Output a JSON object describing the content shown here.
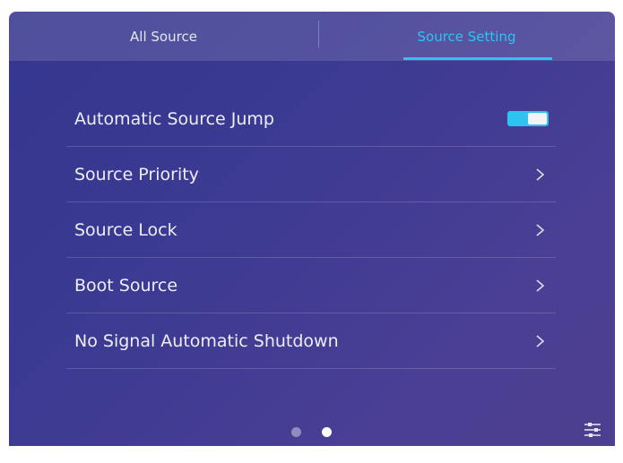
{
  "tabs": [
    {
      "label": "All Source",
      "active": false
    },
    {
      "label": "Source Setting",
      "active": true
    }
  ],
  "settings": {
    "automatic_source_jump": {
      "label": "Automatic Source Jump",
      "enabled": true
    },
    "source_priority": {
      "label": "Source Priority"
    },
    "source_lock": {
      "label": "Source Lock"
    },
    "boot_source": {
      "label": "Boot Source"
    },
    "no_signal_shutdown": {
      "label": "No Signal Automatic Shutdown"
    }
  },
  "pagination": {
    "pages": 2,
    "current": 2
  },
  "icons": {
    "row_arrow": "chevron-right-icon",
    "settings": "sliders-icon"
  },
  "colors": {
    "accent": "#2ec3f0",
    "background": "#3a3990",
    "text": "#eeeef7"
  }
}
